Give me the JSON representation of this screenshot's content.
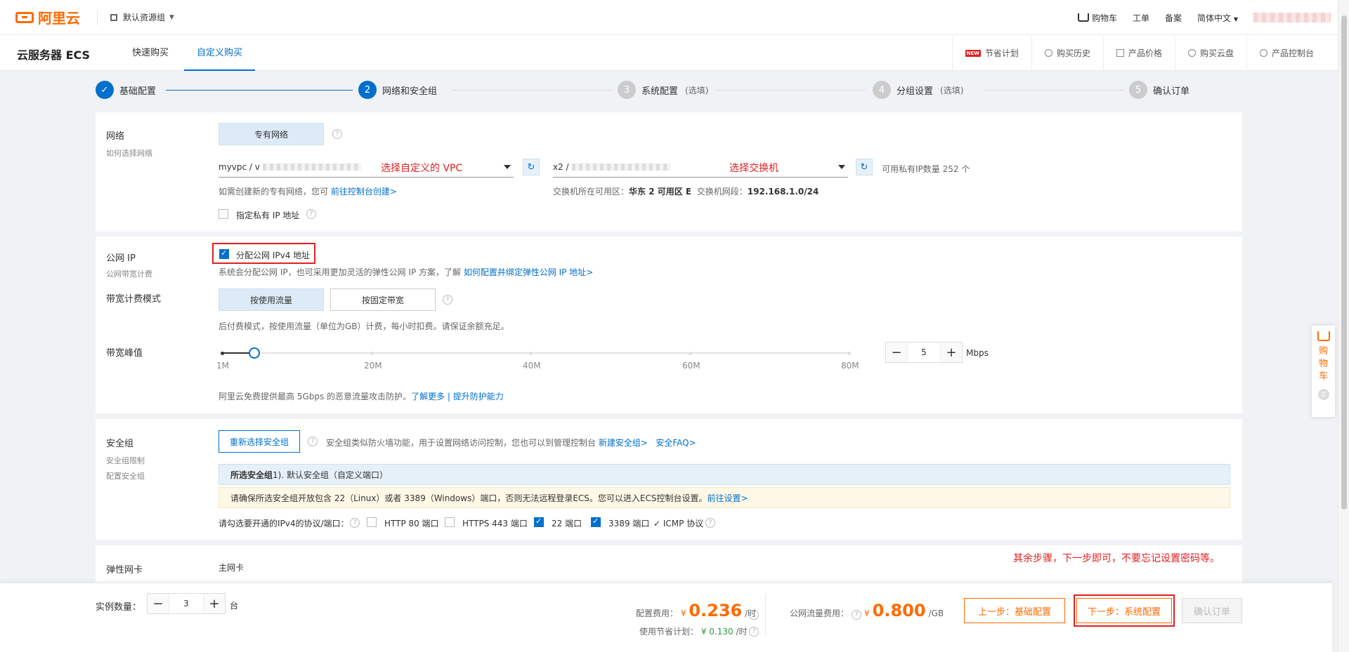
{
  "topbar": {
    "logo": "阿里云",
    "resource_group": "默认资源组",
    "links": [
      "购物车",
      "工单",
      "备案",
      "简体中文"
    ]
  },
  "subnav": {
    "product": "云服务器 ECS",
    "tabs": [
      "快速购买",
      "自定义购买"
    ],
    "right": [
      "节省计划",
      "购买历史",
      "产品价格",
      "购买云盘",
      "产品控制台"
    ],
    "new_tag": "NEW"
  },
  "steps": [
    {
      "num": "1",
      "label": "基础配置",
      "opt": ""
    },
    {
      "num": "2",
      "label": "网络和安全组",
      "opt": ""
    },
    {
      "num": "3",
      "label": "系统配置",
      "opt": "(选填)"
    },
    {
      "num": "4",
      "label": "分组设置",
      "opt": "(选填)"
    },
    {
      "num": "5",
      "label": "确认订单",
      "opt": ""
    }
  ],
  "network": {
    "label": "网络",
    "sublabel": "如何选择网络",
    "type_btn": "专有网络",
    "vpc_prefix": "myvpc / v",
    "vpc_note": "选择自定义的 VPC",
    "vsw_prefix": "x2 /",
    "vsw_note": "选择交换机",
    "ip_count": "可用私有IP数量 252 个",
    "hint_pre": "如需创建新的专有网络，您可",
    "hint_link": "前往控制台创建>",
    "zone_label": "交换机所在可用区：",
    "zone_value": "华东 2 可用区 E",
    "cidr_label": "交换机网段：",
    "cidr_value": "192.168.1.0/24",
    "private_ip": "指定私有 IP 地址"
  },
  "public_ip": {
    "label": "公网 IP",
    "sublabel": "公网带宽计费",
    "checkbox": "分配公网 IPv4 地址",
    "desc_pre": "系统会分配公网 IP，也可采用更加灵活的弹性公网 IP 方案，了解",
    "desc_link": "如何配置并绑定弹性公网 IP 地址>",
    "billing_label": "带宽计费模式",
    "billing_opts": [
      "按使用流量",
      "按固定带宽"
    ],
    "billing_desc": "后付费模式，按使用流量（单位为GB）计费，每小时扣费。请保证余额充足。",
    "bw_label": "带宽峰值",
    "ticks": [
      "1M",
      "20M",
      "40M",
      "60M",
      "80M"
    ],
    "bw_value": "5",
    "bw_unit": "Mbps",
    "ddos_pre": "阿里云免费提供最高 5Gbps 的恶意流量攻击防护。",
    "ddos_link1": "了解更多",
    "ddos_sep": " | ",
    "ddos_link2": "提升防护能力"
  },
  "security": {
    "label": "安全组",
    "sub1": "安全组限制",
    "sub2": "配置安全组",
    "btn": "重新选择安全组",
    "desc": "安全组类似防火墙功能，用于设置网络访问控制，您也可以到管理控制台",
    "link1": "新建安全组>",
    "link2": "安全FAQ>",
    "selected_bold": "所选安全组",
    "selected_rest": " 1). 默认安全组（自定义端口）",
    "warn": "请确保所选安全组开放包含 22（Linux）或者 3389（Windows）端口，否则无法远程登录ECS。您可以进入ECS控制台设置。",
    "warn_link": "前往设置>",
    "ports_label": "请勾选要开通的IPv4的协议/端口：",
    "ports": [
      "HTTP 80 端口",
      "HTTPS 443 端口",
      "22 端口",
      "3389 端口"
    ],
    "icmp": "✓ ICMP 协议"
  },
  "eni": {
    "label": "弹性网卡",
    "value": "主网卡",
    "note": "其余步骤，下一步即可，不要忘记设置密码等。"
  },
  "footer": {
    "qty_label": "实例数量：",
    "qty": "3",
    "qty_unit": "台",
    "config_label": "配置费用：",
    "config_price": "0.236",
    "per_hour": "/时",
    "yen": "¥",
    "plan_label": "使用节省计划：",
    "plan_price": "¥ 0.130",
    "traffic_label": "公网流量费用：",
    "traffic_price": "0.800",
    "per_gb": "/GB",
    "prev": "上一步：基础配置",
    "next": "下一步：系统配置",
    "confirm": "确认订单"
  },
  "float_cart": {
    "text": [
      "购",
      "物",
      "车"
    ],
    "count": "0"
  },
  "colors": {
    "brand": "#ff6a00",
    "primary": "#0070cc",
    "annotation": "#e02020"
  }
}
